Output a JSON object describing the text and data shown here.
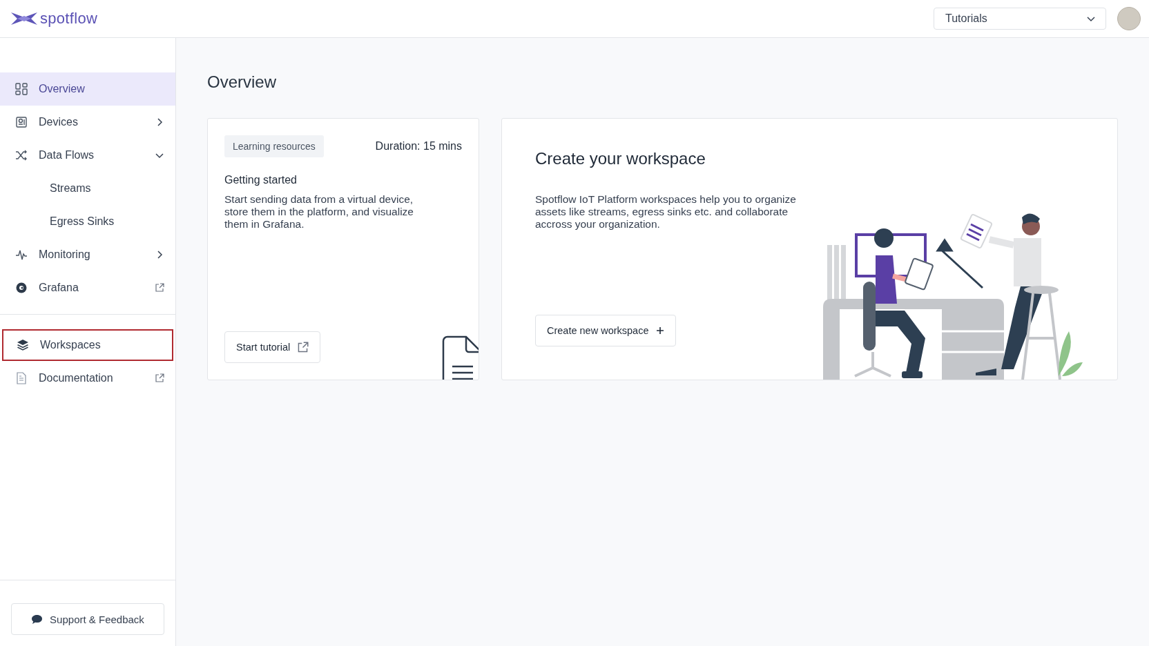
{
  "header": {
    "logo": "spotflow",
    "project_select": {
      "value": "Tutorials"
    }
  },
  "sidebar": {
    "sections": [
      {
        "items": [
          {
            "label": "Overview",
            "selected": true,
            "highlighted": false
          },
          {
            "label": "Devices",
            "selected": false,
            "highlighted": false,
            "expanded": false
          },
          {
            "label": "Data Flows",
            "selected": false,
            "highlighted": false,
            "expanded": true,
            "children": [
              {
                "label": "Streams",
                "selected": false
              },
              {
                "label": "Egress Sinks",
                "selected": false
              }
            ]
          },
          {
            "label": "Monitoring",
            "selected": false,
            "highlighted": false,
            "expanded": false
          },
          {
            "label": "Grafana",
            "selected": false,
            "highlighted": false,
            "external": true
          }
        ]
      },
      {
        "items": [
          {
            "label": "Workspaces",
            "selected": false,
            "highlighted": true
          },
          {
            "label": "Documentation",
            "selected": false,
            "highlighted": false,
            "external": true
          }
        ]
      }
    ],
    "support_button": "Support & Feedback"
  },
  "main": {
    "title": "Overview",
    "tutorial_card": {
      "tag": "Learning resources",
      "duration": "Duration: 15 mins",
      "title": "Getting started",
      "description": "Start sending data from a virtual device, store them in the platform, and visualize them in Grafana.",
      "button": "Start tutorial"
    },
    "workspace_card": {
      "title": "Create your workspace",
      "description": "Spotflow IoT Platform workspaces help you to organize assets like streams, egress sinks etc. and collaborate accross your organization.",
      "button": "Create new workspace"
    }
  }
}
